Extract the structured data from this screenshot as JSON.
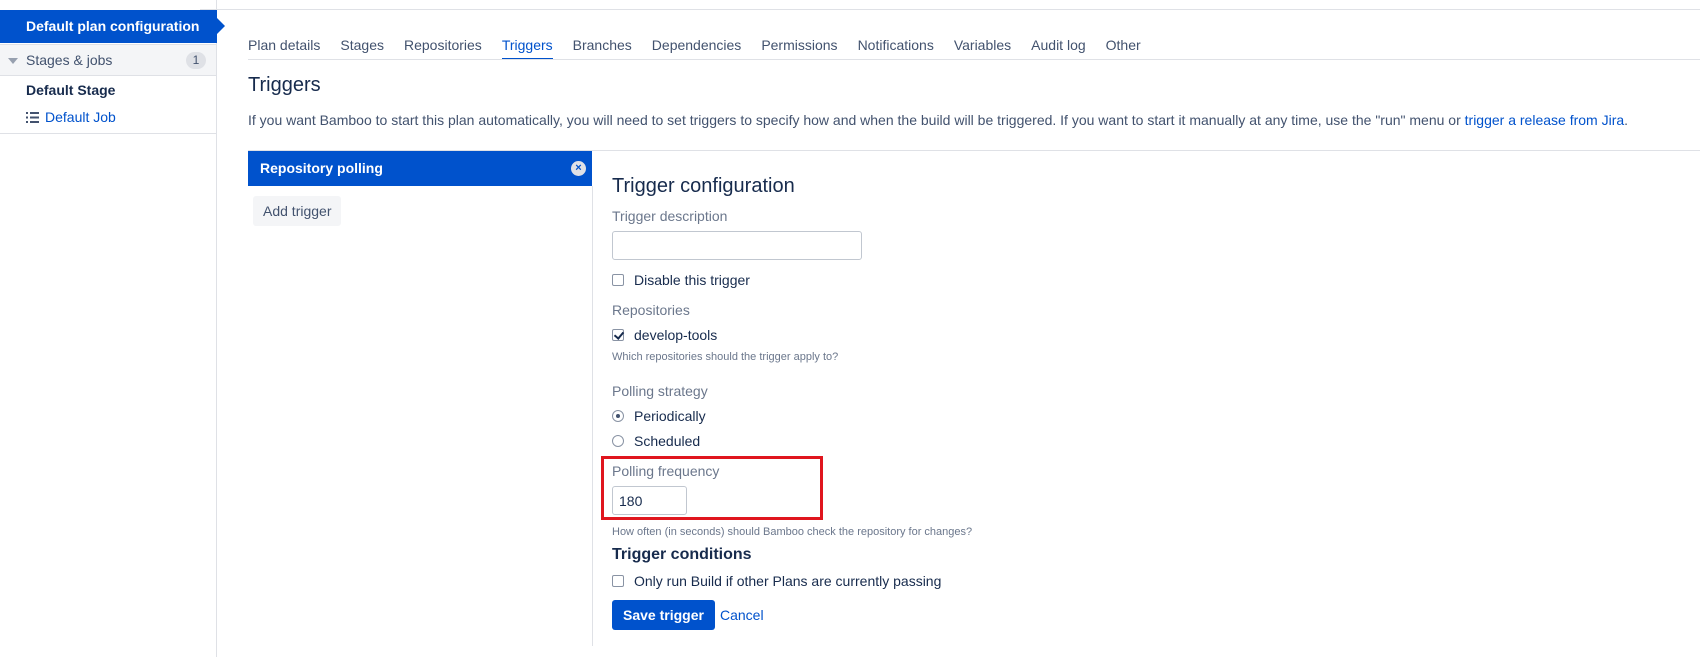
{
  "sidebar": {
    "active_item": "Default plan configuration",
    "stages_label": "Stages & jobs",
    "stages_count": "1",
    "stage_name": "Default Stage",
    "job_name": "Default Job"
  },
  "tabs": [
    {
      "label": "Plan details",
      "active": false
    },
    {
      "label": "Stages",
      "active": false
    },
    {
      "label": "Repositories",
      "active": false
    },
    {
      "label": "Triggers",
      "active": true
    },
    {
      "label": "Branches",
      "active": false
    },
    {
      "label": "Dependencies",
      "active": false
    },
    {
      "label": "Permissions",
      "active": false
    },
    {
      "label": "Notifications",
      "active": false
    },
    {
      "label": "Variables",
      "active": false
    },
    {
      "label": "Audit log",
      "active": false
    },
    {
      "label": "Other",
      "active": false
    }
  ],
  "page": {
    "title": "Triggers",
    "intro_text": "If you want Bamboo to start this plan automatically, you will need to set triggers to specify how and when the build will be triggered. If you want to start it manually at any time, use the \"run\" menu or ",
    "intro_link": "trigger a release from Jira",
    "intro_end": "."
  },
  "trigger_list": {
    "item_label": "Repository polling",
    "close_glyph": "×",
    "add_label": "Add trigger"
  },
  "config": {
    "title": "Trigger configuration",
    "description_label": "Trigger description",
    "description_value": "",
    "disable_label": "Disable this trigger",
    "disable_checked": false,
    "repositories_label": "Repositories",
    "repository_name": "develop-tools",
    "repository_checked": true,
    "repositories_help": "Which repositories should the trigger apply to?",
    "polling_strategy_label": "Polling strategy",
    "strategy_periodic": "Periodically",
    "strategy_scheduled": "Scheduled",
    "selected_strategy": "Periodically",
    "frequency_label": "Polling frequency",
    "frequency_value": "180",
    "frequency_help": "How often (in seconds) should Bamboo check the repository for changes?",
    "conditions_title": "Trigger conditions",
    "condition_label": "Only run Build if other Plans are currently passing",
    "condition_checked": false,
    "save_label": "Save trigger",
    "cancel_label": "Cancel"
  },
  "colors": {
    "accent": "#0052cc",
    "highlight": "#e0161e"
  }
}
